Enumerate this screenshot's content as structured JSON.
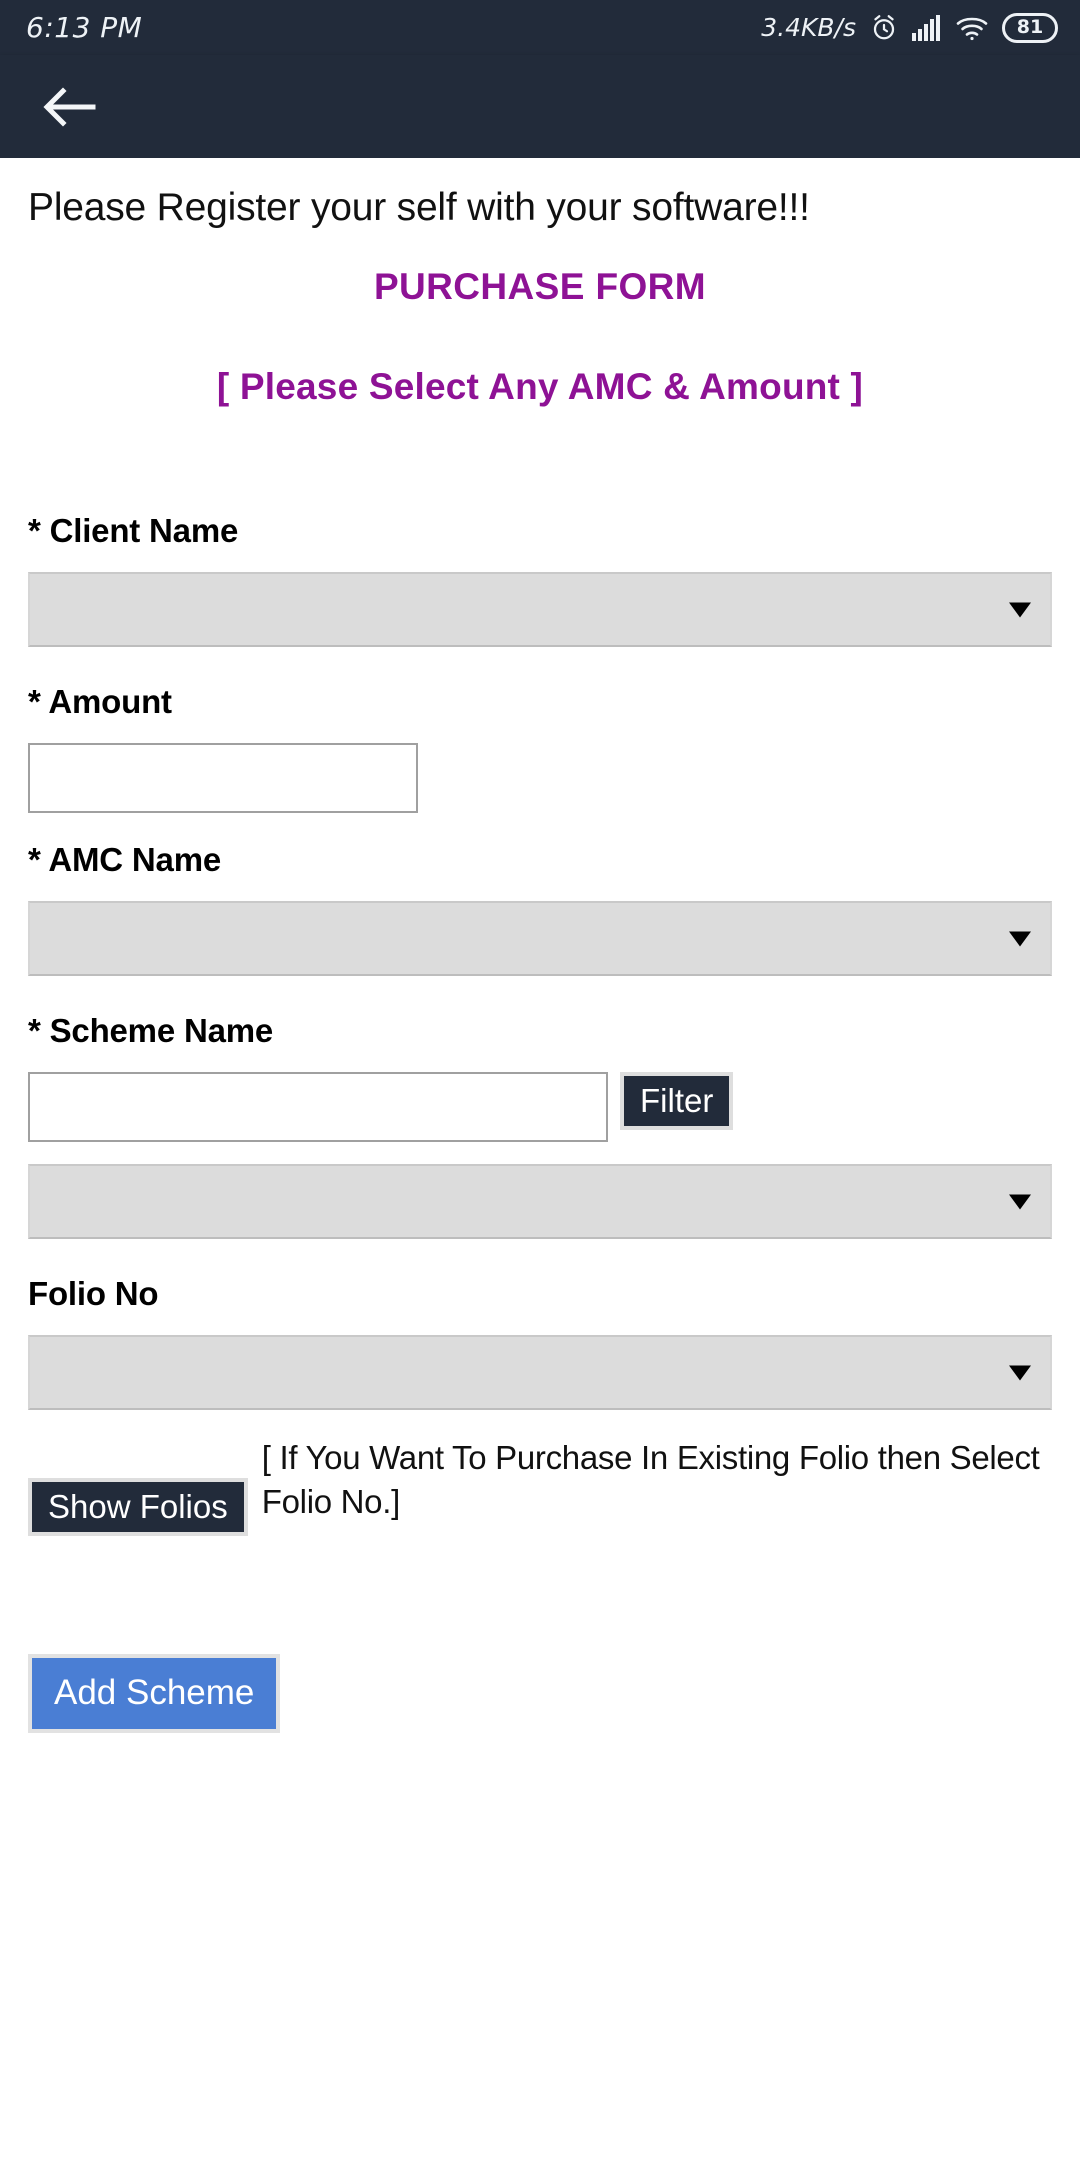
{
  "status_bar": {
    "time": "6:13 PM",
    "network_speed": "3.4KB/s",
    "alarm_icon": "alarm-clock-icon",
    "signal_icon": "cellular-signal-icon",
    "wifi_icon": "wifi-icon",
    "battery_level": "81"
  },
  "app_bar": {
    "back_icon": "back-arrow-icon"
  },
  "page": {
    "register_note": "Please Register your self with your software!!!",
    "form_title": "PURCHASE FORM",
    "select_note": "[ Please Select Any AMC & Amount ]",
    "accent_color": "#8e1295",
    "header_color": "#222b3a",
    "primary_button_color": "#4a7ed4"
  },
  "form": {
    "client_name": {
      "label": "* Client Name",
      "value": "",
      "caret_icon": "chevron-down-icon"
    },
    "amount": {
      "label": "* Amount",
      "value": "",
      "placeholder": ""
    },
    "amc_name": {
      "label": "* AMC Name",
      "value": "",
      "caret_icon": "chevron-down-icon"
    },
    "scheme_name": {
      "label": "* Scheme Name",
      "filter_value": "",
      "filter_placeholder": "",
      "filter_button": "Filter",
      "value": "",
      "caret_icon": "chevron-down-icon"
    },
    "folio_no": {
      "label": "Folio No",
      "value": "",
      "caret_icon": "chevron-down-icon",
      "show_folios_button": "Show Folios",
      "hint": "[ If You Want To Purchase In Existing Folio then Select Folio No.]"
    },
    "add_scheme_button": "Add Scheme"
  }
}
